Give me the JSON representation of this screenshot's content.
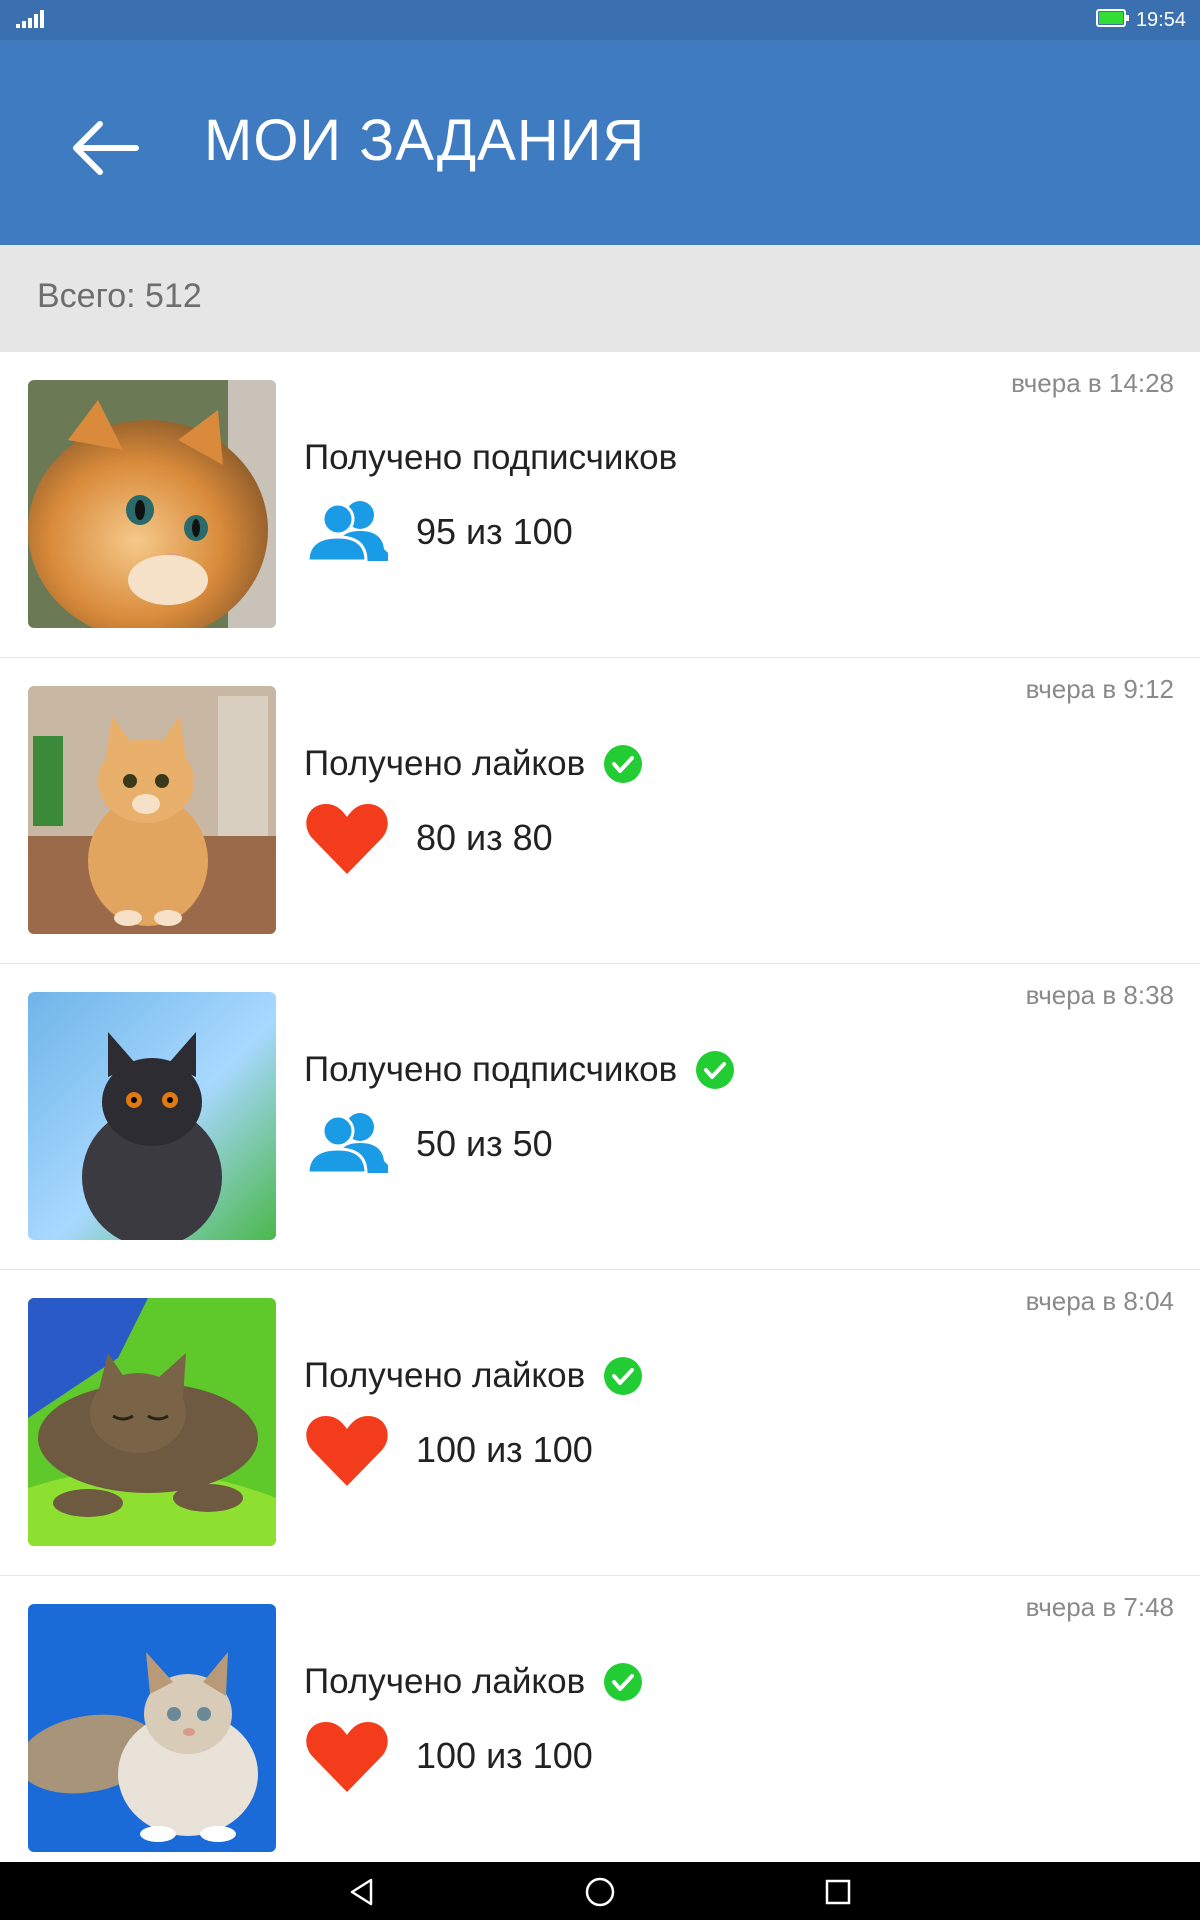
{
  "status_bar": {
    "time": "19:54",
    "battery_color": "#33dd33"
  },
  "header": {
    "title": "МОИ ЗАДАНИЯ",
    "back_icon": "arrow-left-icon",
    "color": "#3f7bc1"
  },
  "summary": {
    "total": "Всего: 512"
  },
  "tasks": [
    {
      "time": "вчера в 14:28",
      "title": "Получено подписчиков",
      "completed": false,
      "type": "followers",
      "icon": "users-icon",
      "progress": "95 из 100"
    },
    {
      "time": "вчера в 9:12",
      "title": "Получено лайков",
      "completed": true,
      "type": "likes",
      "icon": "heart-icon",
      "progress": "80 из 80"
    },
    {
      "time": "вчера в 8:38",
      "title": "Получено подписчиков",
      "completed": true,
      "type": "followers",
      "icon": "users-icon",
      "progress": "50 из 50"
    },
    {
      "time": "вчера в 8:04",
      "title": "Получено лайков",
      "completed": true,
      "type": "likes",
      "icon": "heart-icon",
      "progress": "100 из 100"
    },
    {
      "time": "вчера в 7:48",
      "title": "Получено лайков",
      "completed": true,
      "type": "likes",
      "icon": "heart-icon",
      "progress": "100 из 100"
    }
  ],
  "colors": {
    "heart": "#f23c1c",
    "users": "#1a9be6",
    "check": "#22cc33"
  },
  "nav": {
    "back_icon": "triangle-back-icon",
    "home_icon": "circle-home-icon",
    "recents_icon": "square-recents-icon"
  }
}
